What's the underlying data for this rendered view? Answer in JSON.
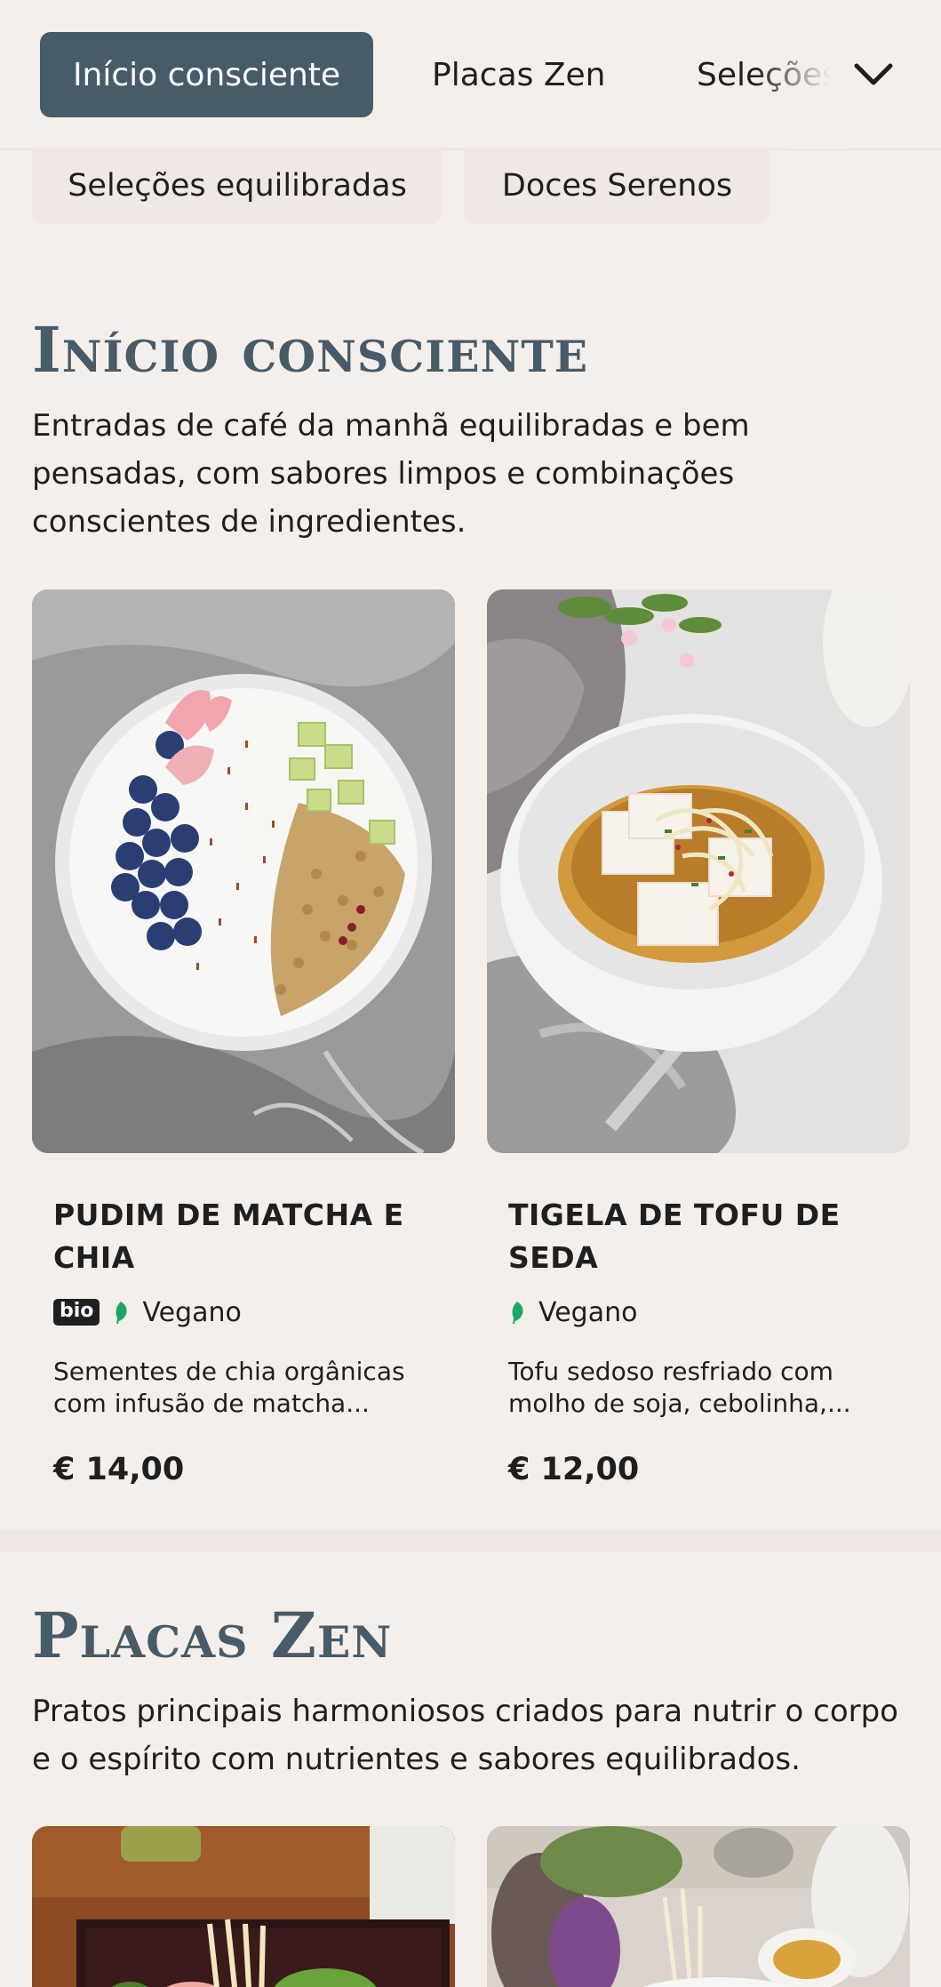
{
  "nav": {
    "tabs": [
      {
        "label": "Início consciente",
        "active": true
      },
      {
        "label": "Placas Zen",
        "active": false
      },
      {
        "label": "Seleções equilibradas",
        "active": false
      }
    ],
    "more_icon": "chevron-down-icon",
    "overflow_chips": [
      "Seleções equilibradas",
      "Doces Serenos"
    ],
    "active_color": "#475b68"
  },
  "sections": [
    {
      "title": "Início consciente",
      "description": "Entradas de café da manhã equilibradas e bem pensadas, com sabores limpos e combinações conscientes de ingredientes.",
      "items": [
        {
          "name": "Pudim de matcha e chia",
          "badges": [
            "bio"
          ],
          "diet_icon": "leaf-icon",
          "diet": "Vegano",
          "description": "Sementes de chia orgânicas com infusão de matcha...",
          "price": "€ 14,00",
          "image": "chia-pudding-bowl-photo"
        },
        {
          "name": "Tigela de tofu de seda",
          "badges": [],
          "diet_icon": "leaf-icon",
          "diet": "Vegano",
          "description": "Tofu sedoso resfriado com molho de soja, cebolinha,...",
          "price": "€ 12,00",
          "image": "silken-tofu-bowl-photo"
        }
      ]
    },
    {
      "title": "Placas Zen",
      "description": "Pratos principais harmoniosos criados para nutrir o corpo e o espírito com nutrientes e sabores equilibrados.",
      "items": [
        {
          "image": "bento-box-photo"
        },
        {
          "image": "noodle-bowl-photo"
        }
      ]
    }
  ],
  "colors": {
    "background": "#f5efeb",
    "accent": "#475b68",
    "vegan_leaf": "#1aa866"
  }
}
